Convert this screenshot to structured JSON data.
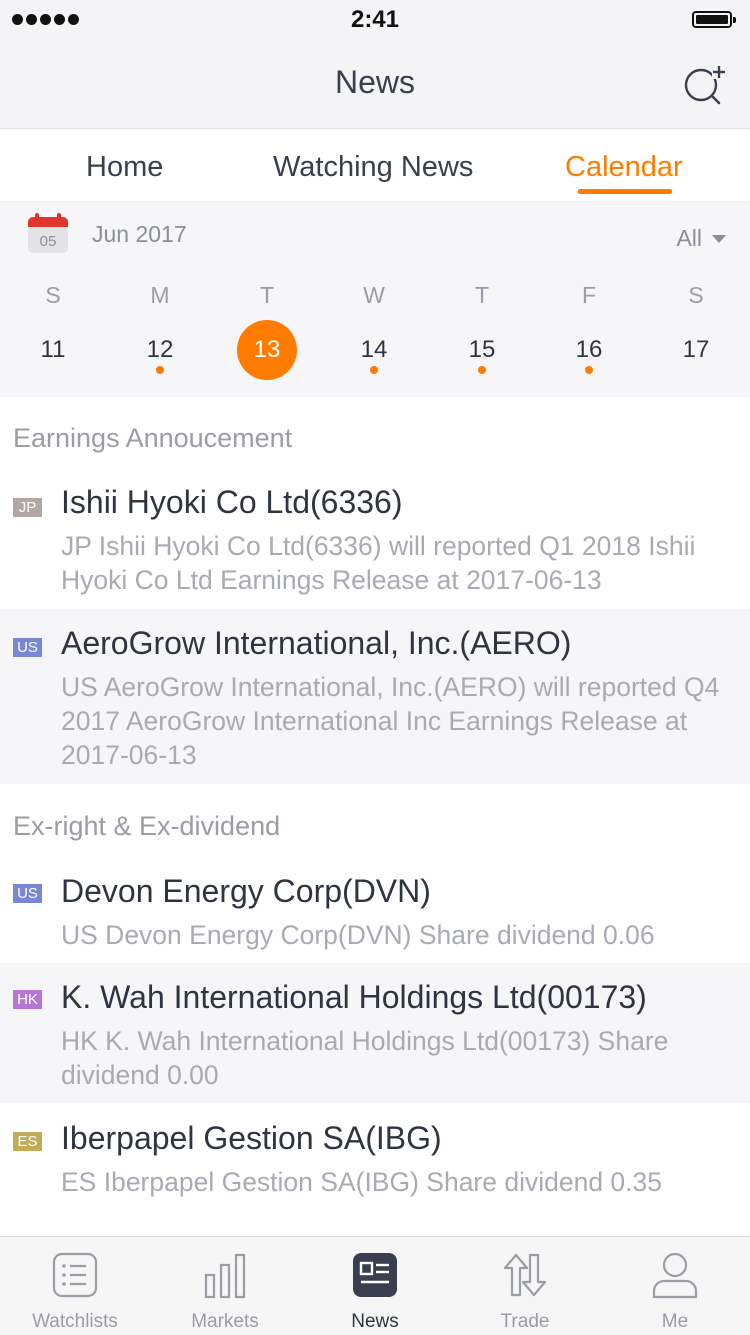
{
  "status_bar": {
    "time": "2:41"
  },
  "nav": {
    "title": "News",
    "action_icon": "search-add-icon"
  },
  "tabs": [
    {
      "label": "Home",
      "active": false
    },
    {
      "label": "Watching News",
      "active": false
    },
    {
      "label": "Calendar",
      "active": true
    }
  ],
  "calendar": {
    "icon_day": "05",
    "month": "Jun 2017",
    "filter": "All",
    "weekdays": [
      "S",
      "M",
      "T",
      "W",
      "T",
      "F",
      "S"
    ],
    "days": [
      {
        "num": "11",
        "has_event": false,
        "selected": false
      },
      {
        "num": "12",
        "has_event": true,
        "selected": false
      },
      {
        "num": "13",
        "has_event": false,
        "selected": true
      },
      {
        "num": "14",
        "has_event": true,
        "selected": false
      },
      {
        "num": "15",
        "has_event": true,
        "selected": false
      },
      {
        "num": "16",
        "has_event": true,
        "selected": false
      },
      {
        "num": "17",
        "has_event": false,
        "selected": false
      }
    ]
  },
  "sections": {
    "earnings": {
      "title": "Earnings Annoucement",
      "items": [
        {
          "market": "JP",
          "color": "#b3a7a4",
          "title": "Ishii Hyoki Co Ltd(6336)",
          "desc": "JP Ishii Hyoki Co Ltd(6336) will reported Q1 2018 Ishii Hyoki Co Ltd Earnings Release at 2017-06-13"
        },
        {
          "market": "US",
          "color": "#7887d6",
          "title": "AeroGrow International, Inc.(AERO)",
          "desc": "US AeroGrow International, Inc.(AERO) will reported Q4 2017 AeroGrow International Inc Earnings Release at 2017-06-13"
        }
      ]
    },
    "dividend": {
      "title": "Ex-right & Ex-dividend",
      "items": [
        {
          "market": "US",
          "color": "#7887d6",
          "title": "Devon Energy Corp(DVN)",
          "desc": "US Devon Energy Corp(DVN) Share dividend 0.06"
        },
        {
          "market": "HK",
          "color": "#b776d6",
          "title": "K. Wah International Holdings Ltd(00173)",
          "desc": "HK K. Wah International Holdings Ltd(00173) Share dividend 0.00"
        },
        {
          "market": "ES",
          "color": "#c1ab57",
          "title": "Iberpapel Gestion SA(IBG)",
          "desc": "ES Iberpapel Gestion SA(IBG) Share dividend 0.35"
        }
      ]
    }
  },
  "tabbar": [
    {
      "label": "Watchlists",
      "icon": "watchlist-icon",
      "active": false
    },
    {
      "label": "Markets",
      "icon": "bar-chart-icon",
      "active": false
    },
    {
      "label": "News",
      "icon": "news-icon",
      "active": true
    },
    {
      "label": "Trade",
      "icon": "trade-arrows-icon",
      "active": false
    },
    {
      "label": "Me",
      "icon": "person-icon",
      "active": false
    }
  ],
  "colors": {
    "accent": "#ff7c00"
  }
}
